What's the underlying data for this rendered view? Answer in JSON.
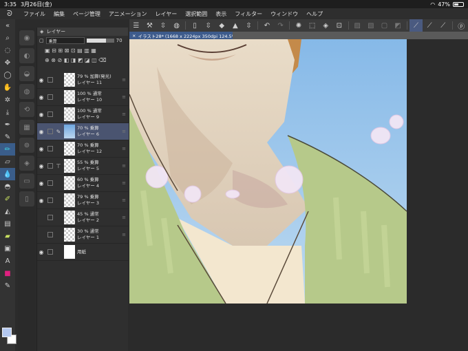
{
  "status": {
    "time": "3:35",
    "date": "3月26日(金)",
    "battery": "47%"
  },
  "menu": [
    "ファイル",
    "編集",
    "ページ管理",
    "アニメーション",
    "レイヤー",
    "選択範囲",
    "表示",
    "フィルター",
    "ウィンドウ",
    "ヘルプ"
  ],
  "document": {
    "tab_title": "イラスト28* (1668 x 2224px 350dpi 124.5%)"
  },
  "layer_panel": {
    "title": "レイヤー",
    "blend_mode": "乗算",
    "opacity": "70",
    "layers": [
      {
        "line1": "79 % 加算(発光)",
        "line2": "レイヤー 11",
        "thumb": "checker",
        "visible": true,
        "selected": false
      },
      {
        "line1": "100 % 通常",
        "line2": "レイヤー 10",
        "thumb": "checker",
        "visible": true,
        "selected": false
      },
      {
        "line1": "100 % 通常",
        "line2": "レイヤー 9",
        "thumb": "checker",
        "visible": true,
        "selected": false
      },
      {
        "line1": "70 % 乗算",
        "line2": "レイヤー 6",
        "thumb": "blue",
        "visible": true,
        "selected": true
      },
      {
        "line1": "70 % 乗算",
        "line2": "レイヤー 12",
        "thumb": "checker",
        "visible": true,
        "selected": false
      },
      {
        "line1": "55 % 乗算",
        "line2": "レイヤー 5",
        "thumb": "checker",
        "visible": true,
        "selected": false
      },
      {
        "line1": "60 % 乗算",
        "line2": "レイヤー 4",
        "thumb": "checker",
        "visible": true,
        "selected": false
      },
      {
        "line1": "79 % 乗算",
        "line2": "レイヤー 3",
        "thumb": "checker",
        "visible": true,
        "selected": false
      },
      {
        "line1": "45 % 通常",
        "line2": "レイヤー 2",
        "thumb": "checker",
        "visible": false,
        "selected": false
      },
      {
        "line1": "30 % 通常",
        "line2": "レイヤー 1",
        "thumb": "checker",
        "visible": false,
        "selected": false
      },
      {
        "line1": "",
        "line2": "用紙",
        "thumb": "white",
        "visible": true,
        "selected": false
      }
    ]
  },
  "colors": {
    "main": "#b4c8f0",
    "sub": "#ffffff",
    "accent": "#3d5b8c"
  }
}
